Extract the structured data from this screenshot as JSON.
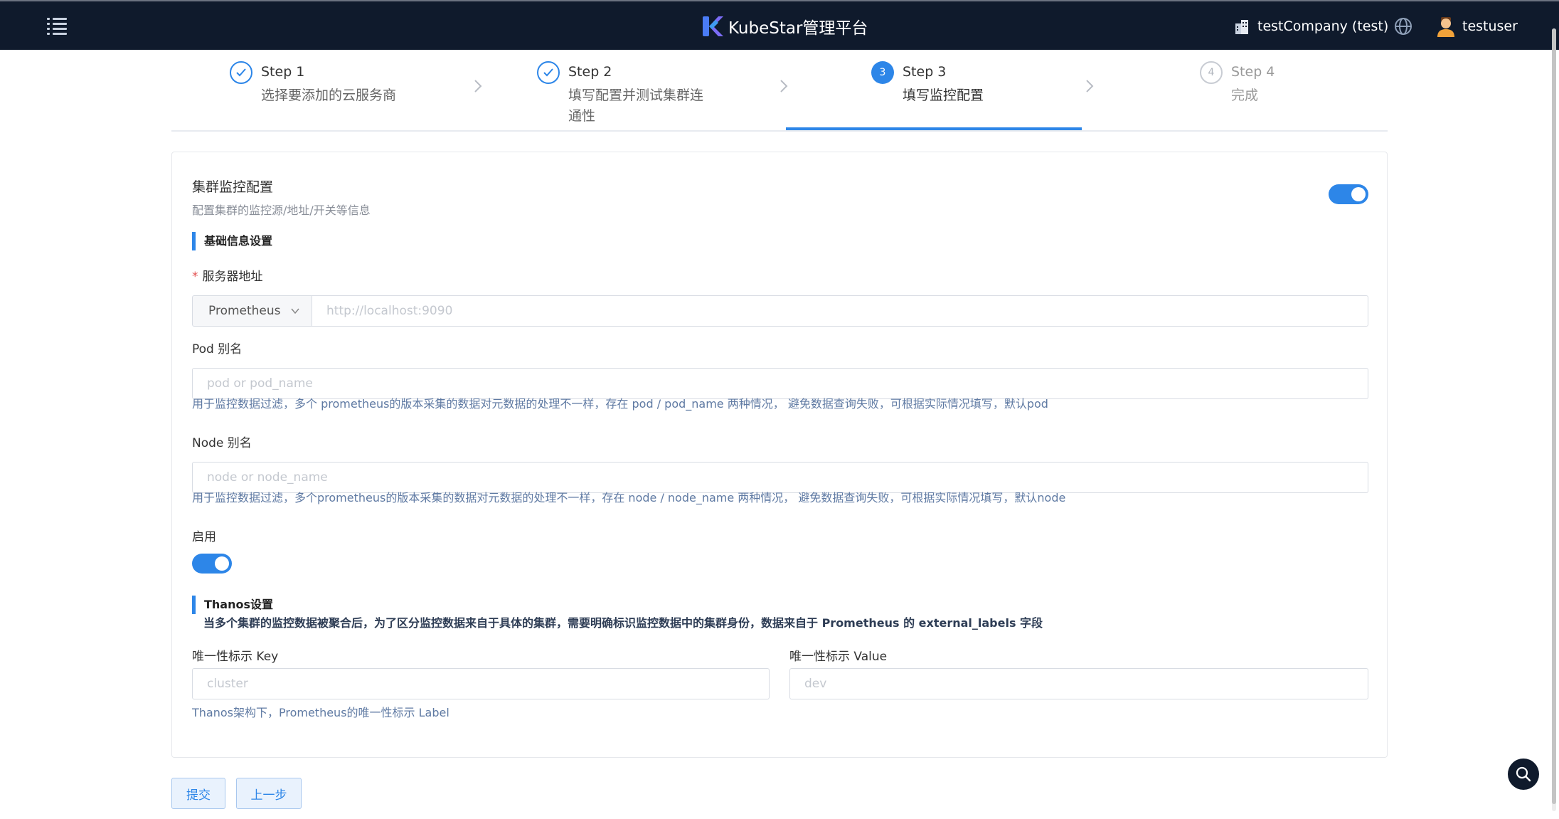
{
  "header": {
    "app_title": "KubeStar管理平台",
    "company": "testCompany (test)",
    "username": "testuser",
    "icons": {
      "menu": "menu-list-icon",
      "company": "building-icon",
      "language": "globe-icon",
      "user": "user-avatar-icon"
    }
  },
  "steps": [
    {
      "index": "1",
      "title": "Step 1",
      "description": "选择要添加的云服务商",
      "status": "done"
    },
    {
      "index": "2",
      "title": "Step 2",
      "description": "填写配置并测试集群连通性",
      "status": "done"
    },
    {
      "index": "3",
      "title": "Step 3",
      "description": "填写监控配置",
      "status": "active"
    },
    {
      "index": "4",
      "title": "Step 4",
      "description": "完成",
      "status": "wait"
    }
  ],
  "card": {
    "title": "集群监控配置",
    "subtitle": "配置集群的监控源/地址/开关等信息",
    "monitor_enabled": true
  },
  "basic": {
    "section_title": "基础信息设置",
    "server_label": "服务器地址",
    "server_type": "Prometheus",
    "server_placeholder": "http://localhost:9090",
    "pod_label": "Pod 别名",
    "pod_placeholder": "pod or pod_name",
    "pod_help": "用于监控数据过滤，多个 prometheus的版本采集的数据对元数据的处理不一样，存在 pod / pod_name 两种情况， 避免数据查询失败，可根据实际情况填写，默认pod",
    "node_label": "Node 别名",
    "node_placeholder": "node or node_name",
    "node_help": "用于监控数据过滤，多个prometheus的版本采集的数据对元数据的处理不一样，存在 node / node_name 两种情况， 避免数据查询失败，可根据实际情况填写，默认node",
    "enable_label": "启用",
    "enabled": true
  },
  "thanos": {
    "section_title": "Thanos设置",
    "description": "当多个集群的监控数据被聚合后，为了区分监控数据来自于具体的集群，需要明确标识监控数据中的集群身份，数据来自于 Prometheus 的 external_labels 字段",
    "key_label": "唯一性标示 Key",
    "key_placeholder": "cluster",
    "value_label": "唯一性标示 Value",
    "value_placeholder": "dev",
    "key_help": "Thanos架构下，Prometheus的唯一性标示 Label"
  },
  "actions": {
    "submit": "提交",
    "previous": "上一步"
  },
  "colors": {
    "primary": "#2d86e8",
    "header_bg": "#0f1a2c",
    "required": "#e34d4d",
    "help_text": "#5f7aa3"
  }
}
